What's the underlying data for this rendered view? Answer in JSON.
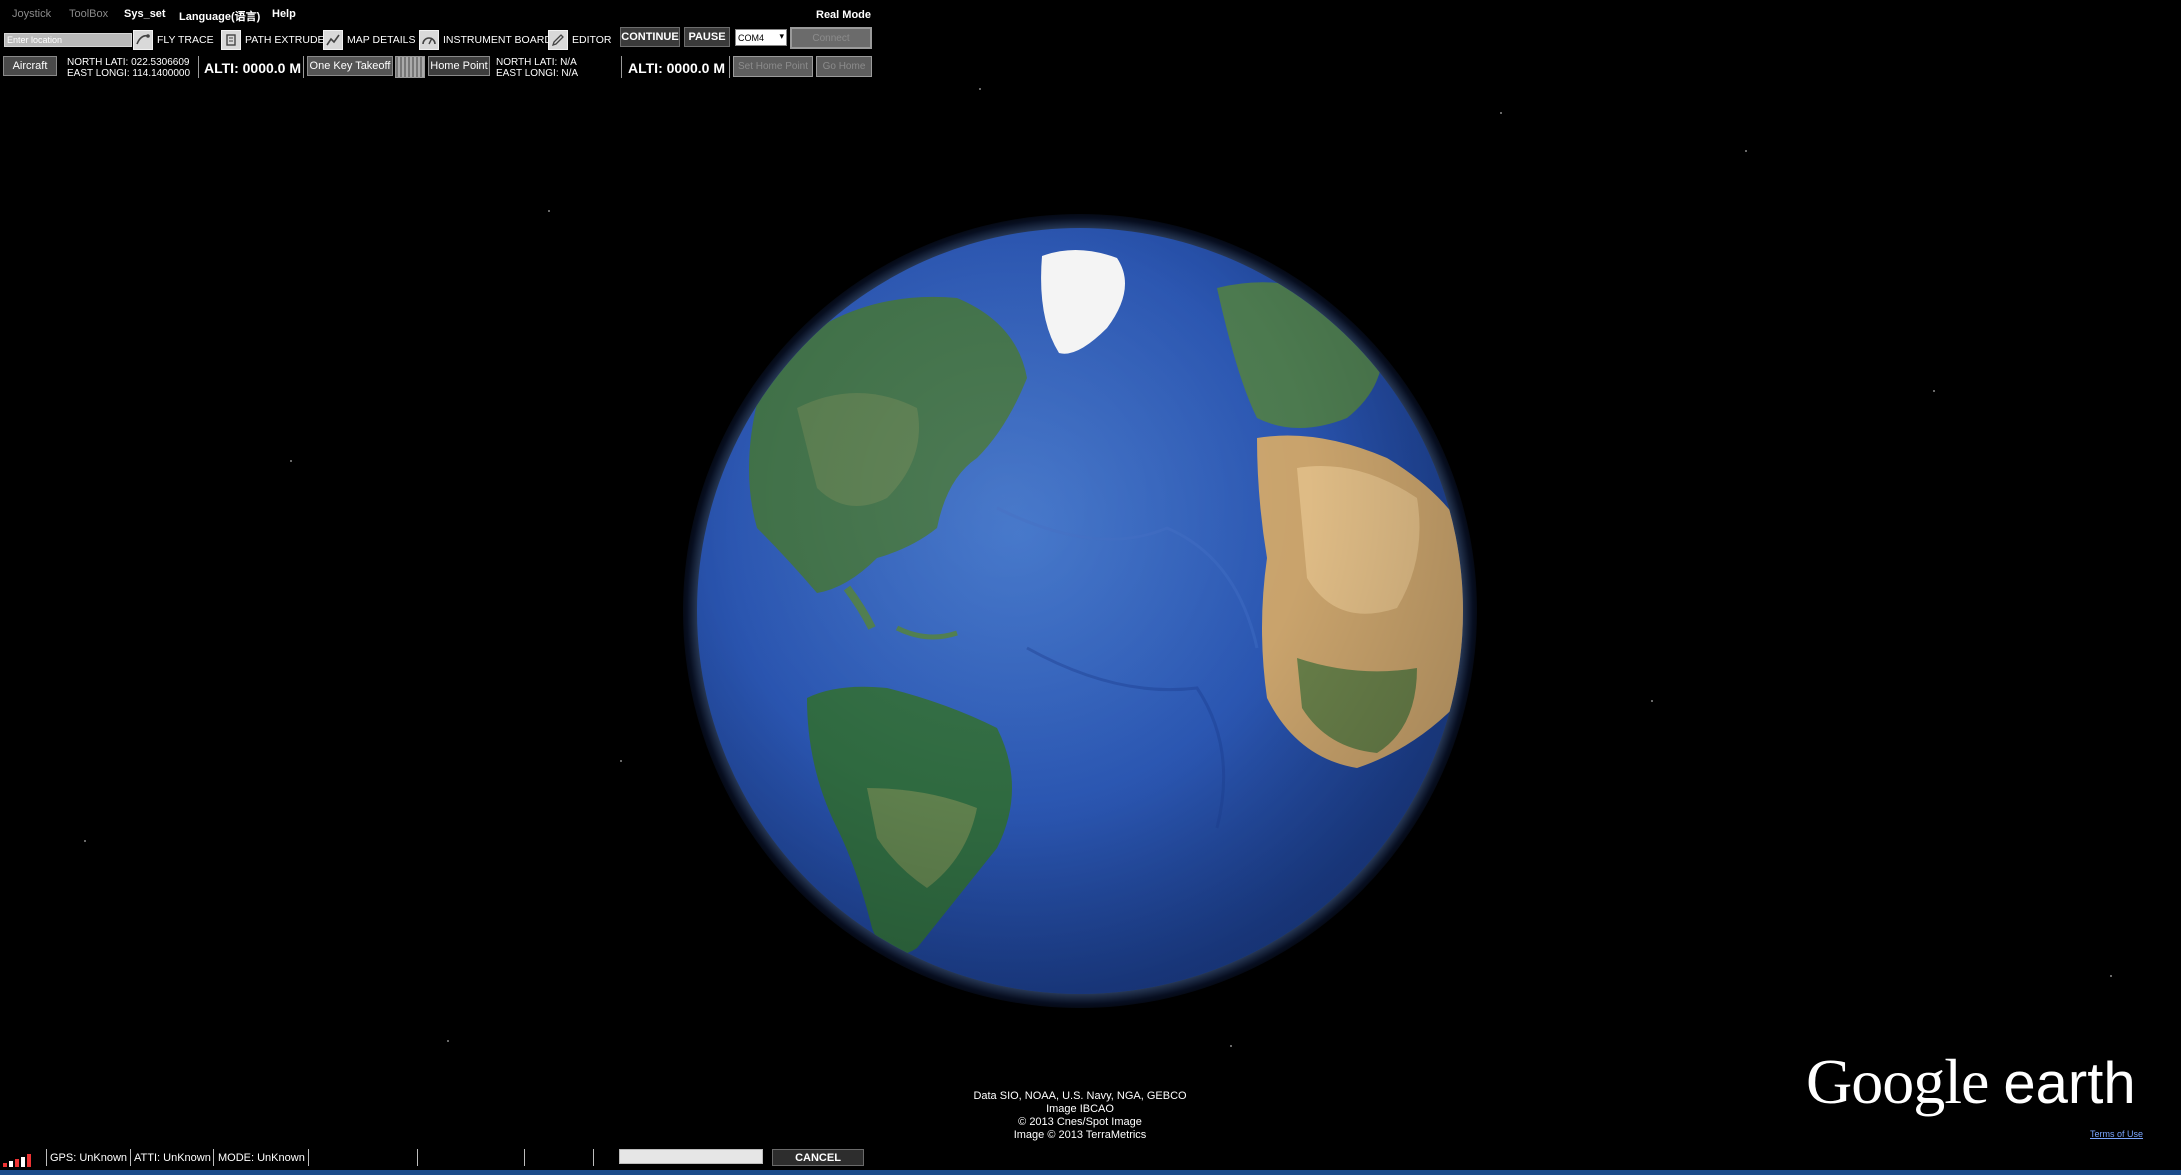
{
  "menu": {
    "items": [
      "Joystick",
      "ToolBox",
      "Sys_set",
      "Language(语言)",
      "Help"
    ],
    "mode": "Real Mode"
  },
  "toolbar": {
    "location_placeholder": "Enter location",
    "fly_trace": "FLY TRACE",
    "path_extrude": "PATH EXTRUDE",
    "map_details": "MAP DETAILS",
    "instrument_board": "INSTRUMENT BOARD",
    "editor": "EDITOR",
    "continue": "CONTINUE",
    "pause": "PAUSE",
    "com_port": "COM4",
    "connect": "Connect"
  },
  "aircraft": {
    "button": "Aircraft",
    "north_lati": "NORTH LATI: 022.5306609",
    "east_longi": "EAST LONGI: 114.1400000",
    "alti": "ALTI: 0000.0  M"
  },
  "controls": {
    "one_key_takeoff": "One Key Takeoff",
    "home_point": "Home Point",
    "home_north_lati": "NORTH LATI: N/A",
    "home_east_longi": "EAST LONGI: N/A",
    "home_alti": "ALTI: 0000.0  M",
    "set_home_point": "Set Home Point",
    "go_home": "Go Home"
  },
  "attribution": {
    "line1": "Data SIO, NOAA, U.S. Navy, NGA, GEBCO",
    "line2": "Image IBCAO",
    "line3": "© 2013 Cnes/Spot Image",
    "line4": "Image © 2013 TerraMetrics"
  },
  "logo": {
    "google": "Google",
    "earth": "earth"
  },
  "terms": "Terms of Use",
  "status": {
    "gps": "GPS: UnKnown",
    "atti": "ATTI: UnKnown",
    "mode": "MODE:  UnKnown",
    "cancel": "CANCEL"
  },
  "colors": {
    "background": "#000000",
    "ocean": "#2a55b0",
    "accent_link": "#7aa6ff"
  }
}
